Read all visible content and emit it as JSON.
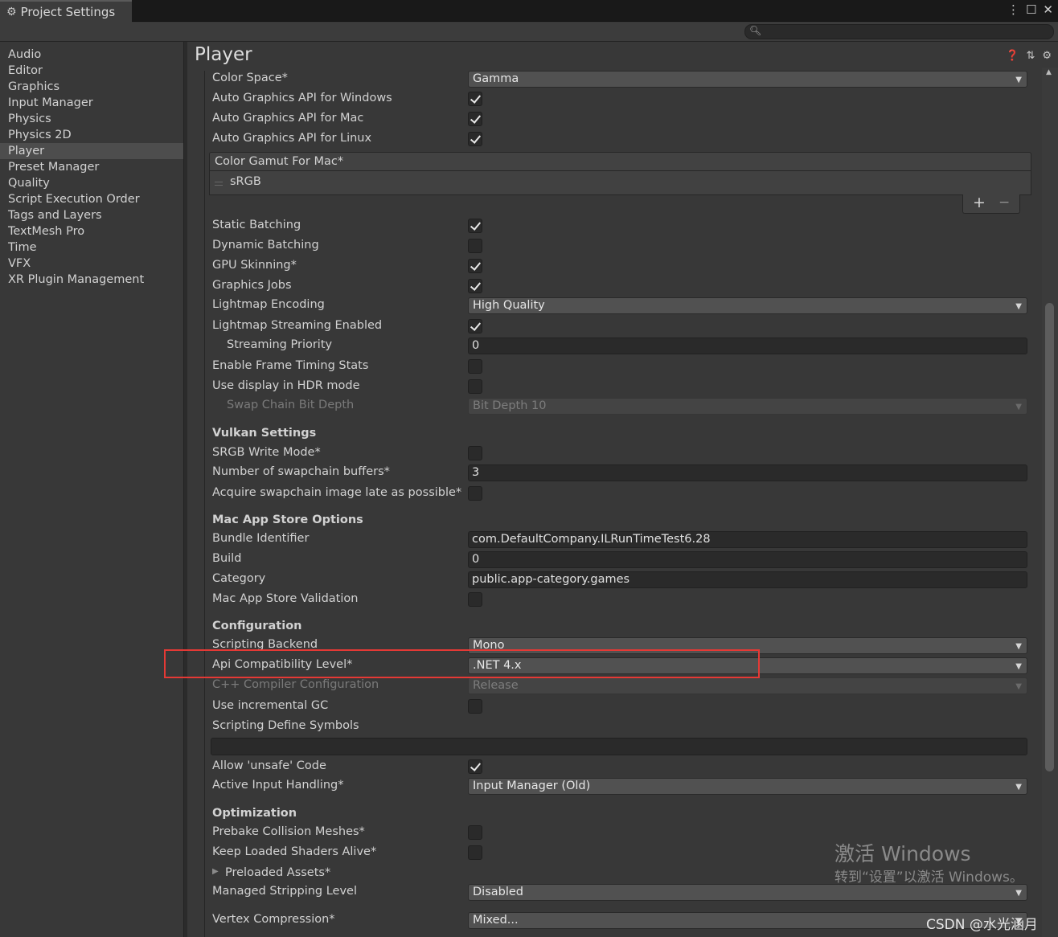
{
  "window": {
    "tab_title": "Project Settings",
    "tab_icon": "gear-icon",
    "controls": [
      "⋮",
      "☐",
      "✕"
    ]
  },
  "search": {
    "placeholder": "",
    "value": ""
  },
  "sidebar": {
    "items": [
      {
        "label": "Audio"
      },
      {
        "label": "Editor"
      },
      {
        "label": "Graphics"
      },
      {
        "label": "Input Manager"
      },
      {
        "label": "Physics"
      },
      {
        "label": "Physics 2D"
      },
      {
        "label": "Player",
        "selected": true
      },
      {
        "label": "Preset Manager"
      },
      {
        "label": "Quality"
      },
      {
        "label": "Script Execution Order"
      },
      {
        "label": "Tags and Layers"
      },
      {
        "label": "TextMesh Pro"
      },
      {
        "label": "Time"
      },
      {
        "label": "VFX"
      },
      {
        "label": "XR Plugin Management"
      }
    ]
  },
  "main": {
    "title": "Player",
    "header_icons": [
      "help-icon",
      "preset-icon",
      "settings-icon"
    ]
  },
  "fields": {
    "color_space": {
      "label": "Color Space*",
      "value": "Gamma"
    },
    "auto_api_windows": {
      "label": "Auto Graphics API  for Windows",
      "checked": true
    },
    "auto_api_mac": {
      "label": "Auto Graphics API  for Mac",
      "checked": true
    },
    "auto_api_linux": {
      "label": "Auto Graphics API  for Linux",
      "checked": true
    },
    "color_gamut": {
      "label": "Color Gamut For Mac*",
      "items": [
        "sRGB"
      ],
      "add": "+",
      "remove": "−"
    },
    "static_batching": {
      "label": "Static Batching",
      "checked": true
    },
    "dynamic_batching": {
      "label": "Dynamic Batching",
      "checked": false
    },
    "gpu_skinning": {
      "label": "GPU Skinning*",
      "checked": true
    },
    "graphics_jobs": {
      "label": "Graphics Jobs",
      "checked": true
    },
    "lightmap_encoding": {
      "label": "Lightmap Encoding",
      "value": "High Quality"
    },
    "lightmap_streaming": {
      "label": "Lightmap Streaming Enabled",
      "checked": true
    },
    "streaming_priority": {
      "label": "Streaming Priority",
      "value": "0"
    },
    "frame_timing": {
      "label": "Enable Frame Timing Stats",
      "checked": false
    },
    "hdr_display": {
      "label": "Use display in HDR mode",
      "checked": false
    },
    "swap_chain_depth": {
      "label": "Swap Chain Bit Depth",
      "value": "Bit Depth 10"
    },
    "vulkan_title": "Vulkan Settings",
    "srgb_write": {
      "label": "SRGB Write Mode*",
      "checked": false
    },
    "swapchain_buffers": {
      "label": "Number of swapchain buffers*",
      "value": "3"
    },
    "acquire_late": {
      "label": "Acquire swapchain image late as possible*",
      "checked": false
    },
    "mac_store_title": "Mac App Store Options",
    "bundle_id": {
      "label": "Bundle Identifier",
      "value": "com.DefaultCompany.ILRunTimeTest6.28"
    },
    "build": {
      "label": "Build",
      "value": "0"
    },
    "category": {
      "label": "Category",
      "value": "public.app-category.games"
    },
    "mac_validation": {
      "label": "Mac App Store Validation",
      "checked": false
    },
    "config_title": "Configuration",
    "scripting_backend": {
      "label": "Scripting Backend",
      "value": "Mono"
    },
    "api_level": {
      "label": "Api Compatibility Level*",
      "value": ".NET 4.x"
    },
    "cpp_config": {
      "label": "C++ Compiler Configuration",
      "value": "Release"
    },
    "incremental_gc": {
      "label": "Use incremental GC",
      "checked": false
    },
    "define_symbols": {
      "label": "Scripting Define Symbols",
      "value": ""
    },
    "unsafe_code": {
      "label": "Allow 'unsafe' Code",
      "checked": true
    },
    "input_handling": {
      "label": "Active Input Handling*",
      "value": "Input Manager (Old)"
    },
    "optim_title": "Optimization",
    "prebake": {
      "label": "Prebake Collision Meshes*",
      "checked": false
    },
    "keep_shaders": {
      "label": "Keep Loaded Shaders Alive*",
      "checked": false
    },
    "preloaded_assets": {
      "label": "Preloaded Assets*"
    },
    "stripping_level": {
      "label": "Managed Stripping Level",
      "value": "Disabled"
    },
    "vertex_compression": {
      "label": "Vertex Compression*",
      "value": "Mixed..."
    }
  },
  "watermark": {
    "activate_title": "激活 Windows",
    "activate_sub": "转到“设置”以激活 Windows。",
    "credit": "CSDN @水光涵月"
  },
  "colors": {
    "annotation": "#e53935",
    "background": "#383838",
    "selected": "#4d4d4d"
  }
}
